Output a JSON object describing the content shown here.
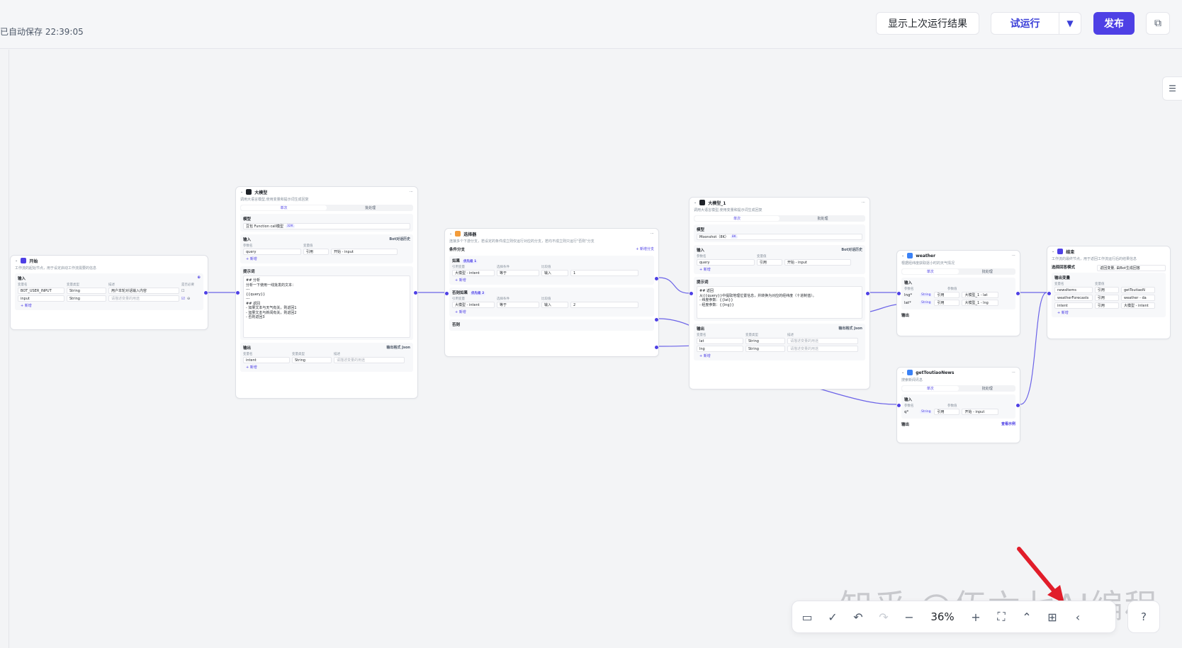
{
  "header": {
    "autosave": "已自动保存 22:39:05",
    "show_last_result": "显示上次运行结果",
    "test_run": "试运行",
    "test_run_dropdown": "▼",
    "publish": "发布",
    "copy_icon": "⧉"
  },
  "side_toggle": "☰",
  "nodes": {
    "start": {
      "title": "开始",
      "desc": "工作流的起始节点，用于设定启动工作流需要的信息",
      "input_title": "输入",
      "col_name": "变量名",
      "col_type": "变量类型",
      "col_desc": "描述",
      "col_required": "是否必要",
      "rows": [
        {
          "name": "BOT_USER_INPUT",
          "type": "String",
          "desc": "用户本轮对话输入内容"
        },
        {
          "name": "input",
          "type": "String",
          "desc": "请描述变量的用途"
        }
      ],
      "add": "+ 新增"
    },
    "llm1": {
      "title": "大模型",
      "desc": "调用大语言模型,使用变量和提示词生成回复",
      "tab_single": "单次",
      "tab_batch": "批处理",
      "model_title": "模型",
      "model_value": "豆包 Function call模型",
      "model_tag": "32K",
      "input_title": "输入",
      "bot_history": "Bot对话历史",
      "col_name": "参数名",
      "col_value": "变量值",
      "row_name": "query",
      "row_ref": "引用",
      "row_val": "开始 - input",
      "add": "+ 新增",
      "prompt_title": "提示词",
      "prompt": "## 分析\n分析一下使用一线批发的文本：\n---\n{{query}}\n---\n## 返回\n- 如果文本与天气有关，则返回1\n- 如果文本与新闻有关，则返回2\n- 否则返回3",
      "output_title": "输出",
      "output_format": "输出格式 Json",
      "out_col_name": "变量名",
      "out_col_type": "变量类型",
      "out_col_desc": "描述",
      "out_name": "intent",
      "out_type": "String",
      "out_desc": "请描述变量的用途"
    },
    "selector": {
      "title": "选择器",
      "desc": "连接多个下游分支，若设定的条件成立则仅运行对应的分支，若均不成立则只运行\"否则\"分支",
      "branch_title": "条件分支",
      "add_branch": "+ 新增分支",
      "if_label": "如果",
      "if_tag": "优先级 1",
      "elif_label": "否则如果",
      "elif_tag": "优先级 2",
      "col_var": "引用变量",
      "col_op": "选择条件",
      "col_cmp": "比较值",
      "cond1": {
        "var": "大模型 - intent",
        "op": "等于",
        "src": "输入",
        "val": "1"
      },
      "cond2": {
        "var": "大模型 - intent",
        "op": "等于",
        "src": "输入",
        "val": "2"
      },
      "add": "+ 新增",
      "else_label": "否则"
    },
    "llm2": {
      "title": "大模型_1",
      "desc": "调用大语言模型,使用变量和提示词生成回复",
      "tab_single": "单次",
      "tab_batch": "批处理",
      "model_title": "模型",
      "model_value": "Moonshot（8K）",
      "model_tag": "8K",
      "input_title": "输入",
      "bot_history": "Bot对话历史",
      "col_name": "参数名",
      "col_value": "变量值",
      "row_name": "query",
      "row_ref": "引用",
      "row_val": "开始 - input",
      "add": "+ 新增",
      "prompt_title": "提示词",
      "prompt": "## 返回\n从{{query}}中提取地理位置信息，并转换为对应的经纬度（十进制值）。\n- 纬度参数：{{lat}}\n- 经度参数：{{lng}}",
      "output_title": "输出",
      "output_format": "输出格式 Json",
      "out_col_name": "变量名",
      "out_col_type": "变量类型",
      "out_col_desc": "描述",
      "outputs": [
        {
          "name": "lat",
          "type": "String",
          "desc": "请描述变量的用途"
        },
        {
          "name": "lng",
          "type": "String",
          "desc": "请描述变量的用途"
        }
      ]
    },
    "weather": {
      "title": "weather",
      "desc": "根据经纬度获取逐小时的天气情况",
      "tab_single": "单次",
      "tab_batch": "批处理",
      "input_title": "输入",
      "col_name": "参数名",
      "col_value": "参数值",
      "rows": [
        {
          "name": "lng*",
          "type": "String",
          "ref": "引用",
          "val": "大模型_1 - lat"
        },
        {
          "name": "lat*",
          "type": "String",
          "ref": "引用",
          "val": "大模型_1 - lng"
        }
      ],
      "output_title": "输出"
    },
    "news": {
      "title": "getToutiaoNews",
      "desc": "搜索新闻讯息",
      "tab_single": "单次",
      "tab_batch": "批处理",
      "input_title": "输入",
      "col_name": "参数名",
      "col_value": "参数值",
      "row": {
        "name": "q*",
        "type": "String",
        "ref": "引用",
        "val": "开始 - input"
      },
      "output_title": "输出",
      "view_example": "查看示例"
    },
    "end": {
      "title": "结束",
      "desc": "工作流的最终节点，用于返回工作流运行后的结果信息",
      "answer_mode_label": "选择回答模式",
      "answer_mode_value": "返回变量, 由Bot生成回答",
      "output_title": "输出变量",
      "col_name": "变量名",
      "col_value": "变量值",
      "rows": [
        {
          "name": "newsItems",
          "ref": "引用",
          "val": "getToutiaoN"
        },
        {
          "name": "weatherForecasts",
          "ref": "引用",
          "val": "weather - da"
        },
        {
          "name": "intent",
          "ref": "引用",
          "val": "大模型 - intent"
        }
      ],
      "add": "+ 新增"
    }
  },
  "toolbar": {
    "minimap_icon": "▭",
    "check_icon": "✓",
    "undo_icon": "↶",
    "redo_icon": "↷",
    "zoom_out": "−",
    "zoom": "36%",
    "zoom_in": "+",
    "fit_icon": "⛶",
    "collapse_icon": "⌃",
    "layout_icon": "⊞",
    "back_icon": "‹",
    "help": "?"
  },
  "watermark": "知乎 @伍六七AI编程",
  "colors": {
    "accent": "#4e40e5",
    "canvas": "#f3f4f6"
  }
}
